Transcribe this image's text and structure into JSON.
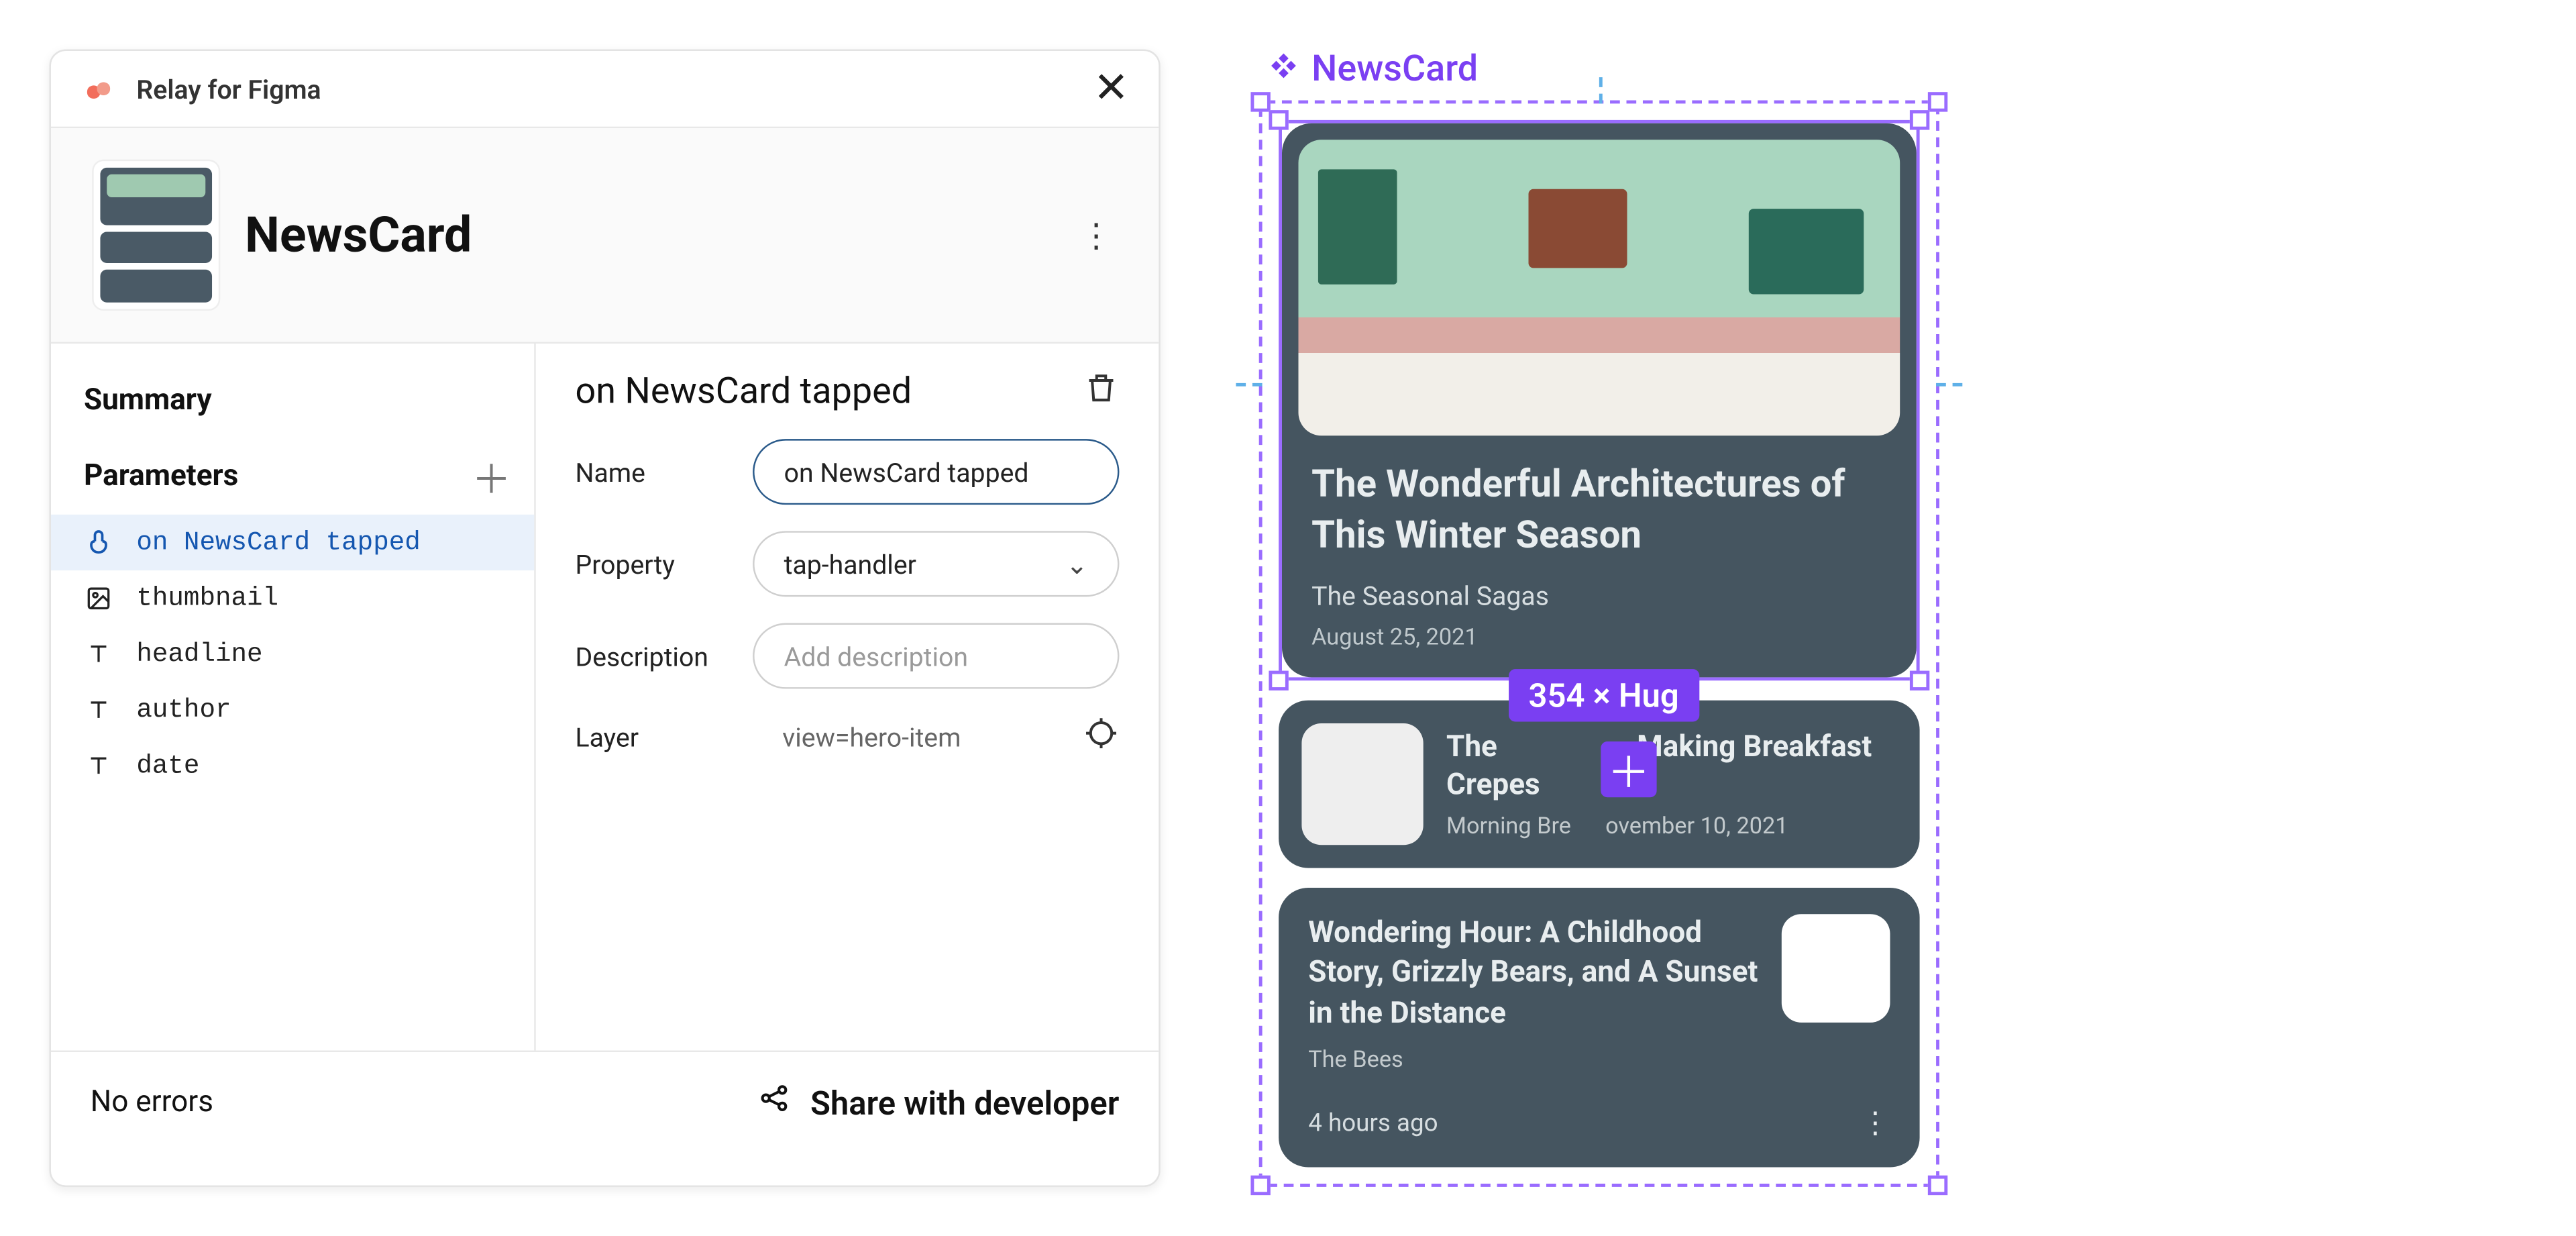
{
  "app": {
    "name": "Relay for Figma"
  },
  "header": {
    "component_title": "NewsCard"
  },
  "sidebar": {
    "summary_title": "Summary",
    "parameters_title": "Parameters",
    "items": [
      {
        "name": "on NewsCard tapped",
        "icon": "tap"
      },
      {
        "name": "thumbnail",
        "icon": "image"
      },
      {
        "name": "headline",
        "icon": "text"
      },
      {
        "name": "author",
        "icon": "text"
      },
      {
        "name": "date",
        "icon": "text"
      }
    ]
  },
  "detail": {
    "title": "on NewsCard tapped",
    "name_label": "Name",
    "name_value": "on NewsCard tapped",
    "property_label": "Property",
    "property_value": "tap-handler",
    "description_label": "Description",
    "description_placeholder": "Add description",
    "layer_label": "Layer",
    "layer_value": "view=hero-item"
  },
  "footer": {
    "status": "No errors",
    "share_label": "Share with developer"
  },
  "canvas": {
    "component_label": "NewsCard",
    "size_badge": "354 × Hug",
    "cards": [
      {
        "headline": "The Wonderful Architectures of This Winter Season",
        "author": "The Seasonal Sagas",
        "date": "August 25, 2021"
      },
      {
        "headline_prefix": "The",
        "headline_suffix": "Making Breakfast Crepes",
        "meta_prefix": "Morning Bre",
        "meta_suffix": "ovember 10, 2021"
      },
      {
        "headline": "Wondering Hour: A Childhood Story, Grizzly Bears, and A Sunset in the Distance",
        "author": "The Bees",
        "ago": "4 hours ago"
      }
    ]
  }
}
